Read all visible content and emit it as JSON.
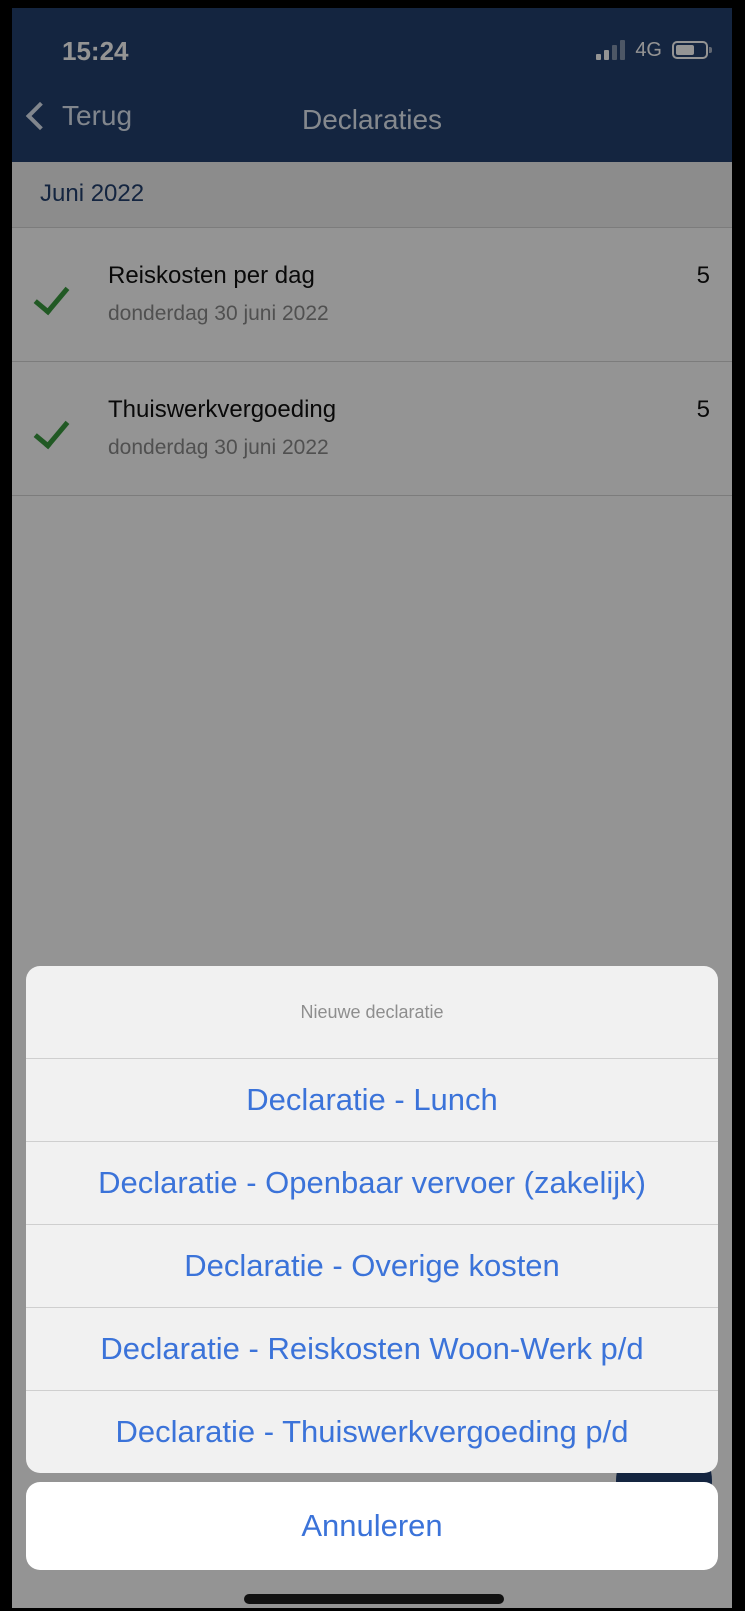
{
  "status_bar": {
    "time": "15:24",
    "network": "4G",
    "icons": [
      "signal-icon",
      "battery-icon"
    ]
  },
  "nav": {
    "back_label": "Terug",
    "title": "Declaraties"
  },
  "list": {
    "section_label": "Juni 2022",
    "items": [
      {
        "title": "Reiskosten per dag",
        "date": "donderdag 30 juni 2022",
        "count": "5",
        "status_icon": "checkmark-icon"
      },
      {
        "title": "Thuiswerkvergoeding",
        "date": "donderdag 30 juni 2022",
        "count": "5",
        "status_icon": "checkmark-icon"
      }
    ]
  },
  "action_sheet": {
    "title": "Nieuwe declaratie",
    "options": [
      "Declaratie - Lunch",
      "Declaratie - Openbaar vervoer (zakelijk)",
      "Declaratie - Overige kosten",
      "Declaratie - Reiskosten Woon-Werk p/d",
      "Declaratie - Thuiswerkvergoeding p/d"
    ],
    "cancel_label": "Annuleren"
  },
  "colors": {
    "nav_bar": "#23406f",
    "accent_blue": "#3b73d9",
    "check_green": "#3a9a3f"
  }
}
